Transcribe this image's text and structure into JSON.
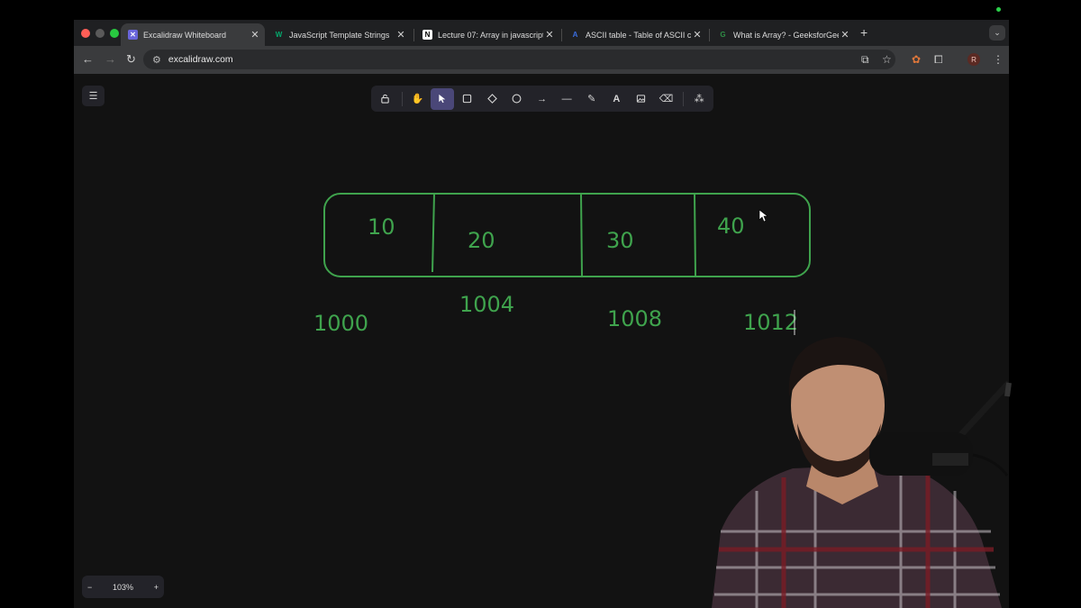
{
  "browser": {
    "tabs": [
      {
        "title": "Excalidraw Whiteboard",
        "favicon": "excalidraw-icon",
        "active": true
      },
      {
        "title": "JavaScript Template Strings",
        "favicon": "w3schools-icon",
        "active": false
      },
      {
        "title": "Lecture 07: Array in javascript",
        "favicon": "notion-icon",
        "active": false
      },
      {
        "title": "ASCII table - Table of ASCII c",
        "favicon": "ascii-icon",
        "active": false
      },
      {
        "title": "What is Array? - GeeksforGee",
        "favicon": "geeksforgeeks-icon",
        "active": false
      }
    ],
    "new_tab_label": "+",
    "url": "excalidraw.com",
    "profile_initial": "R"
  },
  "excalidraw": {
    "tools": [
      "lock-icon",
      "hand-icon",
      "selection-icon",
      "rectangle-icon",
      "diamond-icon",
      "ellipse-icon",
      "arrow-icon",
      "line-icon",
      "pencil-icon",
      "text-icon",
      "image-icon",
      "eraser-icon",
      "library-icon"
    ],
    "active_tool": "selection-icon",
    "zoom_level": "103%",
    "zoom_out_label": "−",
    "zoom_in_label": "+"
  },
  "drawing": {
    "array_values": [
      "10",
      "20",
      "30",
      "40"
    ],
    "addresses": [
      "1000",
      "1004",
      "1008",
      "1012"
    ],
    "stroke_color": "#3fa34d"
  },
  "colors": {
    "canvas_bg": "#121212",
    "toolbar_bg": "#232329",
    "active_tool_bg": "#4a4778"
  }
}
